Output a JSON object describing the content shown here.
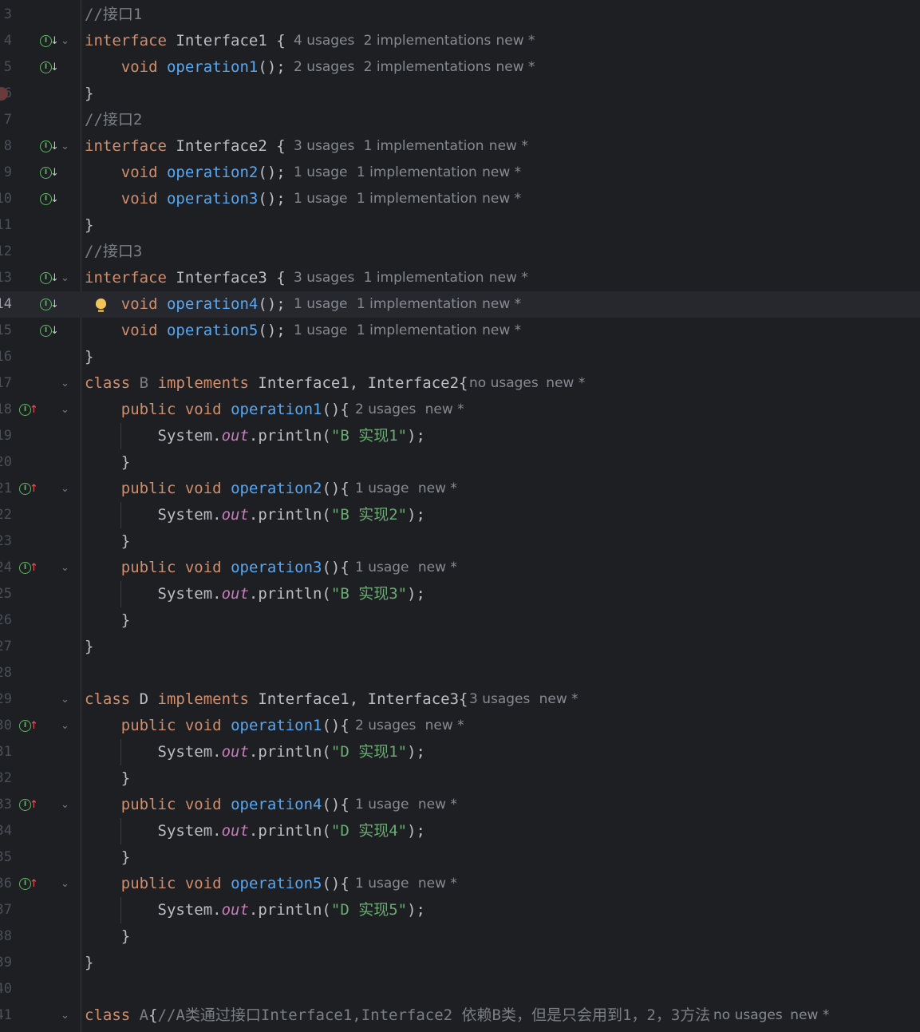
{
  "editor": {
    "colors": {
      "background": "#1e1f22",
      "keyword": "#cf8e6d",
      "function": "#56a8f5",
      "string": "#6aab73",
      "comment": "#7a7e85",
      "static_field": "#c77dbb",
      "hint": "#868a91"
    },
    "lines": [
      {
        "num": "3",
        "code": [
          {
            "t": "//接口1",
            "c": "cmt"
          }
        ]
      },
      {
        "num": "4",
        "icon": "implemented-down-icon",
        "fold": true,
        "code": [
          {
            "t": "interface",
            "c": "kw"
          },
          {
            "t": " Interface1 {"
          }
        ],
        "hints": [
          "4 usages",
          "2 implementations",
          "new *"
        ]
      },
      {
        "num": "5",
        "icon": "implemented-down-icon",
        "code": [
          {
            "t": "    "
          },
          {
            "t": "void",
            "c": "kw"
          },
          {
            "t": " "
          },
          {
            "t": "operation1",
            "c": "fn"
          },
          {
            "t": "();"
          }
        ],
        "hints": [
          "2 usages",
          "2 implementations",
          "new *"
        ]
      },
      {
        "num": "6",
        "breakpoint": true,
        "code": [
          {
            "t": "}"
          }
        ]
      },
      {
        "num": "7",
        "code": [
          {
            "t": "//接口2",
            "c": "cmt"
          }
        ]
      },
      {
        "num": "8",
        "icon": "implemented-down-icon",
        "fold": true,
        "code": [
          {
            "t": "interface",
            "c": "kw"
          },
          {
            "t": " Interface2 {"
          }
        ],
        "hints": [
          "3 usages",
          "1 implementation",
          "new *"
        ]
      },
      {
        "num": "9",
        "icon": "implemented-down-icon",
        "code": [
          {
            "t": "    "
          },
          {
            "t": "void",
            "c": "kw"
          },
          {
            "t": " "
          },
          {
            "t": "operation2",
            "c": "fn"
          },
          {
            "t": "();"
          }
        ],
        "hints": [
          "1 usage",
          "1 implementation",
          "new *"
        ]
      },
      {
        "num": "10",
        "icon": "implemented-down-icon",
        "code": [
          {
            "t": "    "
          },
          {
            "t": "void",
            "c": "kw"
          },
          {
            "t": " "
          },
          {
            "t": "operation3",
            "c": "fn"
          },
          {
            "t": "();"
          }
        ],
        "hints": [
          "1 usage",
          "1 implementation",
          "new *"
        ]
      },
      {
        "num": "11",
        "code": [
          {
            "t": "}"
          }
        ]
      },
      {
        "num": "12",
        "code": [
          {
            "t": "//接口3",
            "c": "cmt"
          }
        ]
      },
      {
        "num": "13",
        "icon": "implemented-down-icon",
        "fold": true,
        "code": [
          {
            "t": "interface",
            "c": "kw"
          },
          {
            "t": " Interface3 {"
          }
        ],
        "hints": [
          "3 usages",
          "1 implementation",
          "new *"
        ]
      },
      {
        "num": "14",
        "icon": "implemented-down-icon",
        "caret": true,
        "bulb": true,
        "code": [
          {
            "t": "    "
          },
          {
            "t": "void",
            "c": "kw"
          },
          {
            "t": " "
          },
          {
            "t": "operation4",
            "c": "fn"
          },
          {
            "t": "();"
          }
        ],
        "hints": [
          "1 usage",
          "1 implementation",
          "new *"
        ]
      },
      {
        "num": "15",
        "icon": "implemented-down-icon",
        "code": [
          {
            "t": "    "
          },
          {
            "t": "void",
            "c": "kw"
          },
          {
            "t": " "
          },
          {
            "t": "operation5",
            "c": "fn"
          },
          {
            "t": "();"
          }
        ],
        "hints": [
          "1 usage",
          "1 implementation",
          "new *"
        ]
      },
      {
        "num": "16",
        "code": [
          {
            "t": "}"
          }
        ]
      },
      {
        "num": "17",
        "fold": true,
        "code": [
          {
            "t": "class",
            "c": "kw"
          },
          {
            "t": " "
          },
          {
            "t": "B",
            "c": "cmt"
          },
          {
            "t": " "
          },
          {
            "t": "implements",
            "c": "kw"
          },
          {
            "t": " Interface1, Interface2{"
          }
        ],
        "hints": [
          "no usages",
          "new *"
        ]
      },
      {
        "num": "18",
        "icon": "implements-up-icon",
        "fold": true,
        "code": [
          {
            "t": "    "
          },
          {
            "t": "public",
            "c": "kw"
          },
          {
            "t": " "
          },
          {
            "t": "void",
            "c": "kw"
          },
          {
            "t": " "
          },
          {
            "t": "operation1",
            "c": "fn"
          },
          {
            "t": "(){"
          }
        ],
        "hints": [
          "2 usages",
          "new *"
        ]
      },
      {
        "num": "19",
        "guide": true,
        "code": [
          {
            "t": "        System."
          },
          {
            "t": "out",
            "c": "fld"
          },
          {
            "t": ".println("
          },
          {
            "t": "\"B 实现1\"",
            "c": "str"
          },
          {
            "t": ");"
          }
        ]
      },
      {
        "num": "20",
        "code": [
          {
            "t": "    }"
          }
        ]
      },
      {
        "num": "21",
        "icon": "implements-up-icon",
        "fold": true,
        "code": [
          {
            "t": "    "
          },
          {
            "t": "public",
            "c": "kw"
          },
          {
            "t": " "
          },
          {
            "t": "void",
            "c": "kw"
          },
          {
            "t": " "
          },
          {
            "t": "operation2",
            "c": "fn"
          },
          {
            "t": "(){"
          }
        ],
        "hints": [
          "1 usage",
          "new *"
        ]
      },
      {
        "num": "22",
        "guide": true,
        "code": [
          {
            "t": "        System."
          },
          {
            "t": "out",
            "c": "fld"
          },
          {
            "t": ".println("
          },
          {
            "t": "\"B 实现2\"",
            "c": "str"
          },
          {
            "t": ");"
          }
        ]
      },
      {
        "num": "23",
        "code": [
          {
            "t": "    }"
          }
        ]
      },
      {
        "num": "24",
        "icon": "implements-up-icon",
        "fold": true,
        "code": [
          {
            "t": "    "
          },
          {
            "t": "public",
            "c": "kw"
          },
          {
            "t": " "
          },
          {
            "t": "void",
            "c": "kw"
          },
          {
            "t": " "
          },
          {
            "t": "operation3",
            "c": "fn"
          },
          {
            "t": "(){"
          }
        ],
        "hints": [
          "1 usage",
          "new *"
        ]
      },
      {
        "num": "25",
        "guide": true,
        "code": [
          {
            "t": "        System."
          },
          {
            "t": "out",
            "c": "fld"
          },
          {
            "t": ".println("
          },
          {
            "t": "\"B 实现3\"",
            "c": "str"
          },
          {
            "t": ");"
          }
        ]
      },
      {
        "num": "26",
        "code": [
          {
            "t": "    }"
          }
        ]
      },
      {
        "num": "27",
        "code": [
          {
            "t": "}"
          }
        ]
      },
      {
        "num": "28",
        "code": []
      },
      {
        "num": "29",
        "fold": true,
        "code": [
          {
            "t": "class",
            "c": "kw"
          },
          {
            "t": " D "
          },
          {
            "t": "implements",
            "c": "kw"
          },
          {
            "t": " Interface1, Interface3{"
          }
        ],
        "hints": [
          "3 usages",
          "new *"
        ]
      },
      {
        "num": "30",
        "icon": "implements-up-icon",
        "fold": true,
        "code": [
          {
            "t": "    "
          },
          {
            "t": "public",
            "c": "kw"
          },
          {
            "t": " "
          },
          {
            "t": "void",
            "c": "kw"
          },
          {
            "t": " "
          },
          {
            "t": "operation1",
            "c": "fn"
          },
          {
            "t": "(){"
          }
        ],
        "hints": [
          "2 usages",
          "new *"
        ]
      },
      {
        "num": "31",
        "guide": true,
        "code": [
          {
            "t": "        System."
          },
          {
            "t": "out",
            "c": "fld"
          },
          {
            "t": ".println("
          },
          {
            "t": "\"D 实现1\"",
            "c": "str"
          },
          {
            "t": ");"
          }
        ]
      },
      {
        "num": "32",
        "code": [
          {
            "t": "    }"
          }
        ]
      },
      {
        "num": "33",
        "icon": "implements-up-icon",
        "fold": true,
        "code": [
          {
            "t": "    "
          },
          {
            "t": "public",
            "c": "kw"
          },
          {
            "t": " "
          },
          {
            "t": "void",
            "c": "kw"
          },
          {
            "t": " "
          },
          {
            "t": "operation4",
            "c": "fn"
          },
          {
            "t": "(){"
          }
        ],
        "hints": [
          "1 usage",
          "new *"
        ]
      },
      {
        "num": "34",
        "guide": true,
        "code": [
          {
            "t": "        System."
          },
          {
            "t": "out",
            "c": "fld"
          },
          {
            "t": ".println("
          },
          {
            "t": "\"D 实现4\"",
            "c": "str"
          },
          {
            "t": ");"
          }
        ]
      },
      {
        "num": "35",
        "code": [
          {
            "t": "    }"
          }
        ]
      },
      {
        "num": "36",
        "icon": "implements-up-icon",
        "fold": true,
        "code": [
          {
            "t": "    "
          },
          {
            "t": "public",
            "c": "kw"
          },
          {
            "t": " "
          },
          {
            "t": "void",
            "c": "kw"
          },
          {
            "t": " "
          },
          {
            "t": "operation5",
            "c": "fn"
          },
          {
            "t": "(){"
          }
        ],
        "hints": [
          "1 usage",
          "new *"
        ]
      },
      {
        "num": "37",
        "guide": true,
        "code": [
          {
            "t": "        System."
          },
          {
            "t": "out",
            "c": "fld"
          },
          {
            "t": ".println("
          },
          {
            "t": "\"D 实现5\"",
            "c": "str"
          },
          {
            "t": ");"
          }
        ]
      },
      {
        "num": "38",
        "code": [
          {
            "t": "    }"
          }
        ]
      },
      {
        "num": "39",
        "code": [
          {
            "t": "}"
          }
        ]
      },
      {
        "num": "40",
        "code": []
      },
      {
        "num": "41",
        "fold": true,
        "code": [
          {
            "t": "class",
            "c": "kw"
          },
          {
            "t": " "
          },
          {
            "t": "A",
            "c": "cmt"
          },
          {
            "t": "{"
          },
          {
            "t": "//A类通过接口Interface1,Interface2 依赖B类，但是只会用到1，2，3方法",
            "c": "cmt"
          }
        ],
        "hints": [
          "no usages",
          "new *"
        ]
      }
    ]
  }
}
